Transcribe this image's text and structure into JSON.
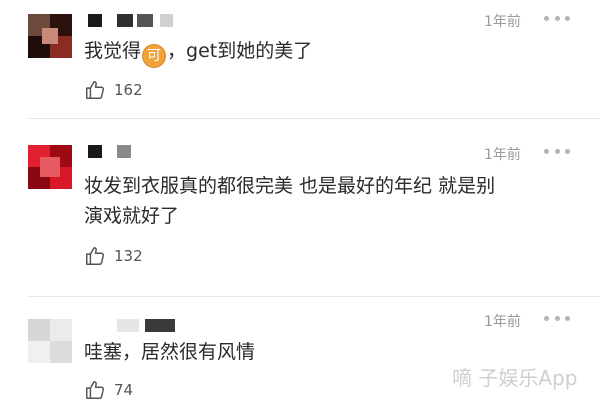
{
  "comments": [
    {
      "time": "1年前",
      "text_before": "我觉得",
      "emoji": "可",
      "text_after": "，get到她的美了",
      "likes": "162"
    },
    {
      "time": "1年前",
      "text_line1": "妆发到衣服真的都很完美 也是最好的年纪 就是别",
      "text_line2": "演戏就好了",
      "likes": "132"
    },
    {
      "time": "1年前",
      "text": "哇塞，居然很有风情",
      "likes": "74"
    }
  ],
  "watermark": "嘀 子娱乐App",
  "colors": {
    "background": "#ffffff",
    "time": "#9a9a9a",
    "divider": "#e6e6e6",
    "emoji": "#f0a23a"
  }
}
